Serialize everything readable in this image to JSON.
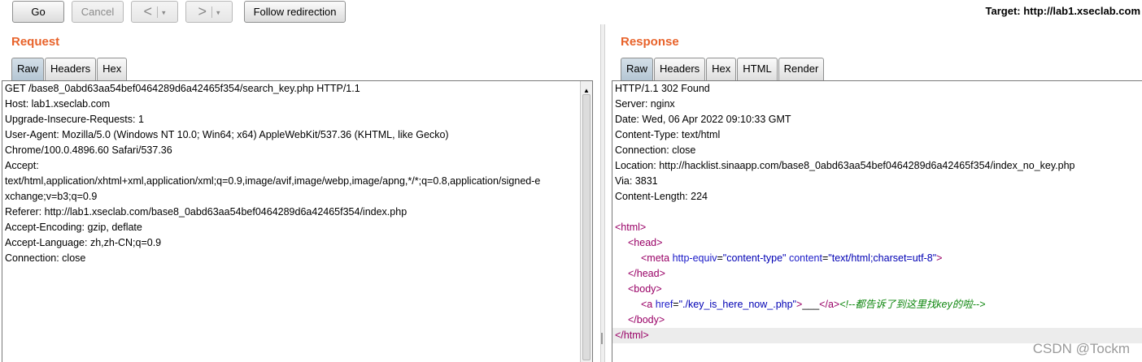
{
  "toolbar": {
    "go_label": "Go",
    "cancel_label": "Cancel",
    "back_glyph": "<",
    "forward_glyph": ">",
    "dropdown_glyph": "▾",
    "follow_label": "Follow redirection",
    "target_label": "Target: http://lab1.xseclab.com"
  },
  "request": {
    "title": "Request",
    "tabs": [
      "Raw",
      "Headers",
      "Hex"
    ],
    "active_tab": "Raw",
    "lines": [
      "GET /base8_0abd63aa54bef0464289d6a42465f354/search_key.php HTTP/1.1",
      "Host: lab1.xseclab.com",
      "Upgrade-Insecure-Requests: 1",
      "User-Agent: Mozilla/5.0 (Windows NT 10.0; Win64; x64) AppleWebKit/537.36 (KHTML, like Gecko)",
      "Chrome/100.0.4896.60 Safari/537.36",
      "Accept:",
      "text/html,application/xhtml+xml,application/xml;q=0.9,image/avif,image/webp,image/apng,*/*;q=0.8,application/signed-e",
      "xchange;v=b3;q=0.9",
      "Referer: http://lab1.xseclab.com/base8_0abd63aa54bef0464289d6a42465f354/index.php",
      "Accept-Encoding: gzip, deflate",
      "Accept-Language: zh,zh-CN;q=0.9",
      "Connection: close"
    ]
  },
  "response": {
    "title": "Response",
    "tabs": [
      "Raw",
      "Headers",
      "Hex",
      "HTML",
      "Render"
    ],
    "active_tab": "Raw",
    "header_lines": [
      "HTTP/1.1 302 Found",
      "Server: nginx",
      "Date: Wed, 06 Apr 2022 09:10:33 GMT",
      "Content-Type: text/html",
      "Connection: close",
      "Location: http://hacklist.sinaapp.com/base8_0abd63aa54bef0464289d6a42465f354/index_no_key.php",
      "Via: 3831",
      "Content-Length: 224"
    ],
    "body": {
      "html_open": "<html>",
      "head_open": "<head>",
      "meta_tag": "<meta",
      "meta_attr1": "http-equiv",
      "meta_val1": "\"content-type\"",
      "meta_attr2": "content",
      "meta_val2": "\"text/html;charset=utf-8\"",
      "meta_close": ">",
      "head_close": "</head>",
      "body_open": "<body>",
      "a_tag": "<a",
      "a_attr": "href",
      "a_val": "\"./key_is_here_now_.php\"",
      "a_gt": ">",
      "a_text": "___",
      "a_close": "</a>",
      "comment": "<!--都告诉了到这里找key的啦-->",
      "body_close": "</body>",
      "html_close": "</html>"
    }
  },
  "watermark": "CSDN @Tockm"
}
